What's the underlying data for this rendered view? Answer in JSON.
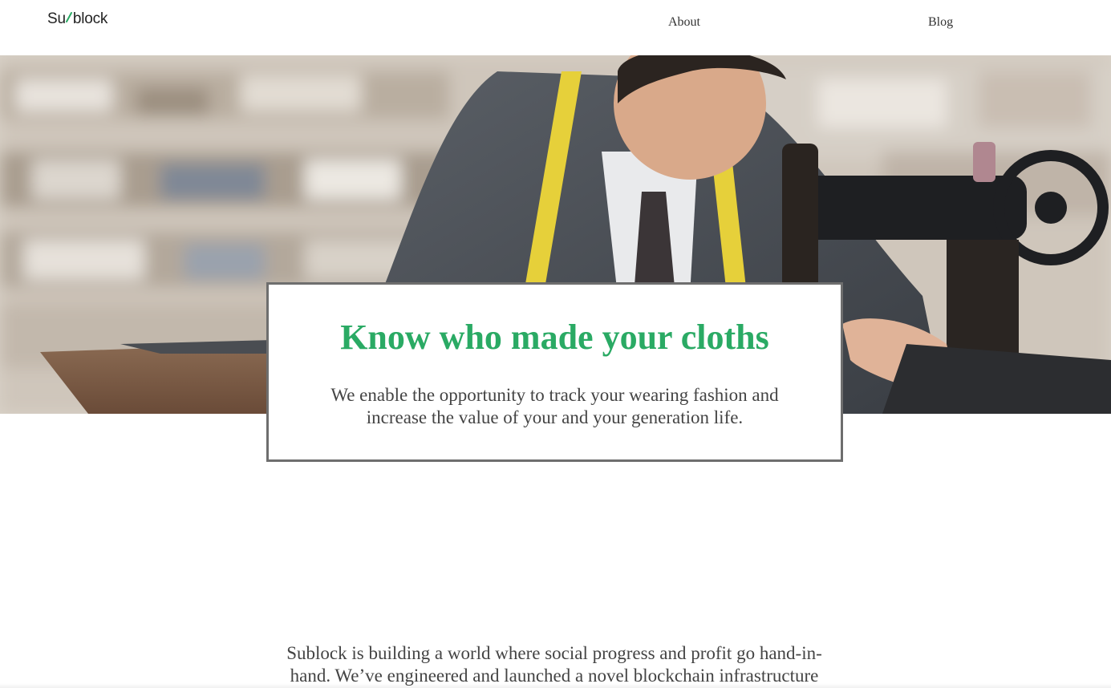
{
  "header": {
    "logo_prefix": "Su",
    "logo_suffix": "block",
    "nav": {
      "about_label": "About",
      "blog_label": "Blog"
    }
  },
  "hero": {
    "image_description": "tailor-with-sewing-machine-photo"
  },
  "card": {
    "title": "Know who made your cloths",
    "text": "We enable the opportunity to track your wearing fashion and increase the value of your and your generation life."
  },
  "about": {
    "text": "Sublock is building a world where social progress and profit go hand-in-hand. We’ve engineered and launched a novel blockchain infrastructure"
  },
  "colors": {
    "accent": "#2aaa64",
    "text": "#444444",
    "card_border": "#6e6e6e"
  }
}
